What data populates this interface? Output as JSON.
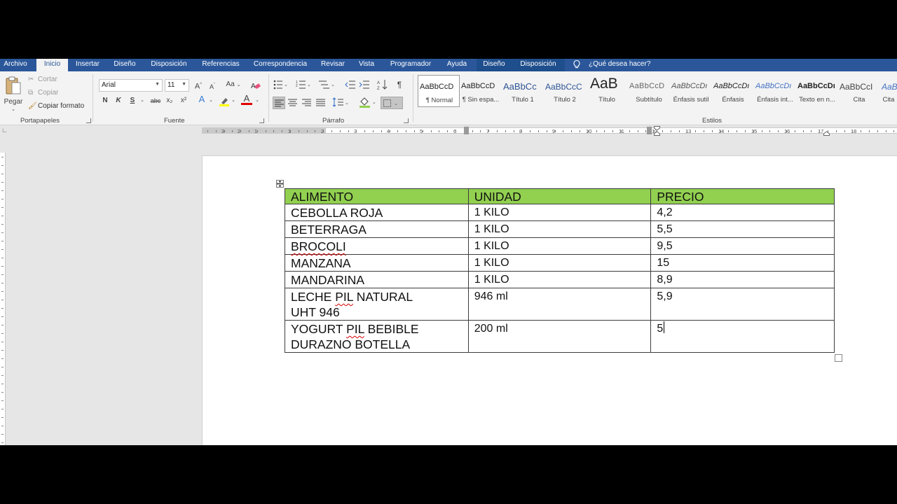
{
  "tabs": [
    {
      "label": "Archivo"
    },
    {
      "label": "Inicio"
    },
    {
      "label": "Insertar"
    },
    {
      "label": "Diseño"
    },
    {
      "label": "Disposición"
    },
    {
      "label": "Referencias"
    },
    {
      "label": "Correspondencia"
    },
    {
      "label": "Revisar"
    },
    {
      "label": "Vista"
    },
    {
      "label": "Programador"
    },
    {
      "label": "Ayuda"
    },
    {
      "label": "Diseño"
    },
    {
      "label": "Disposición"
    }
  ],
  "tell_me": "¿Qué desea hacer?",
  "clipboard": {
    "paste": "Pegar",
    "cut": "Cortar",
    "copy": "Copiar",
    "format_painter": "Copiar formato",
    "group": "Portapapeles"
  },
  "font": {
    "name": "Arial",
    "size": "11",
    "grow": "A",
    "shrink": "A",
    "case": "Aa",
    "bold": "N",
    "italic": "K",
    "underline": "S",
    "strike": "abc",
    "subscript": "x₂",
    "superscript": "x²",
    "effects": "A",
    "color": "A",
    "group": "Fuente"
  },
  "paragraph": {
    "group": "Párrafo",
    "pilcrow": "¶"
  },
  "styles": {
    "group": "Estilos",
    "items": [
      {
        "preview": "AaBbCcD",
        "name": "¶ Normal"
      },
      {
        "preview": "AaBbCcD",
        "name": "¶ Sin espa..."
      },
      {
        "preview": "AaBbCc",
        "name": "Título 1"
      },
      {
        "preview": "AaBbCcC",
        "name": "Título 2"
      },
      {
        "preview": "AaB",
        "name": "Título"
      },
      {
        "preview": "AaBbCcD",
        "name": "Subtítulo"
      },
      {
        "preview": "AaBbCcDı",
        "name": "Énfasis sutil"
      },
      {
        "preview": "AaBbCcDı",
        "name": "Énfasis"
      },
      {
        "preview": "AaBbCcDı",
        "name": "Énfasis int..."
      },
      {
        "preview": "AaBbCcDı",
        "name": "Texto en n..."
      },
      {
        "preview": "AaBbCcI",
        "name": "Cita"
      },
      {
        "preview": "AaBbCcI",
        "name": "Cita"
      }
    ]
  },
  "ruler": {
    "labels": [
      "3",
      "2",
      "1",
      "1",
      "2",
      "3",
      "4",
      "5",
      "6",
      "7",
      "8",
      "9",
      "10",
      "11",
      "12",
      "13",
      "14",
      "15",
      "16",
      "17",
      "18"
    ]
  },
  "table": {
    "headers": [
      "ALIMENTO",
      "UNIDAD",
      "PRECIO"
    ],
    "rows": [
      {
        "alimento": "CEBOLLA ROJA",
        "unidad": "1 KILO",
        "precio": "4,2"
      },
      {
        "alimento": "BETERRAGA",
        "unidad": "1 KILO",
        "precio": "5,5"
      },
      {
        "alimento": "BROCOLI",
        "unidad": "1 KILO",
        "precio": "9,5"
      },
      {
        "alimento": "MANZANA",
        "unidad": "1 KILO",
        "precio": "15"
      },
      {
        "alimento": "MANDARINA",
        "unidad": "1 KILO",
        "precio": "8,9"
      },
      {
        "alimento_a": "LECHE ",
        "alimento_pil": "PIL",
        "alimento_b": " NATURAL",
        "alimento_c": "UHT 946",
        "unidad": "946 ml",
        "precio": "5,9"
      },
      {
        "alimento_a": "YOGURT ",
        "alimento_pil": "PIL",
        "alimento_b": " BEBIBLE",
        "alimento_c": "DURAZNO BOTELLA",
        "unidad": "200 ml",
        "precio": "5"
      }
    ]
  },
  "colors": {
    "ribbon_accent": "#2b579a",
    "header_fill": "#92d050"
  }
}
